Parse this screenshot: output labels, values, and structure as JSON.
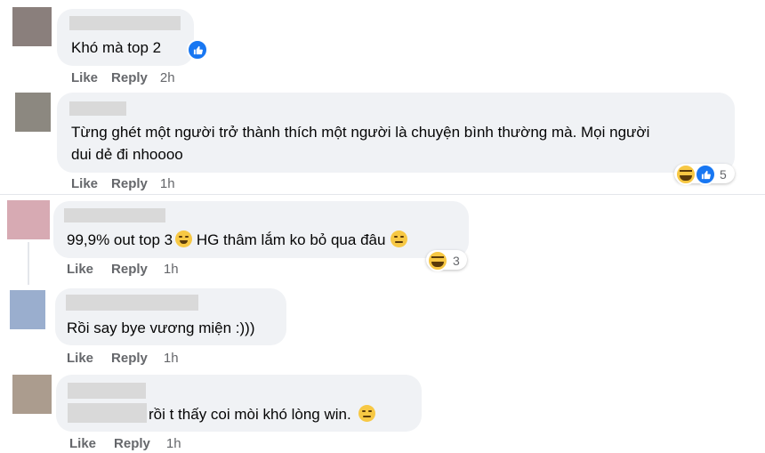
{
  "labels": {
    "like": "Like",
    "reply": "Reply"
  },
  "colors": {
    "bubble": "#f0f2f5",
    "action_text": "#65676b",
    "like_blue": "#1877f2",
    "haha_yellow": "#f7c844"
  },
  "comments": [
    {
      "text": "Khó mà top 2",
      "time": "2h",
      "reactions": [
        "like"
      ],
      "reaction_count": ""
    },
    {
      "text_line1": "Từng ghét một người trở thành thích một người là chuyện bình thường mà. Mọi người",
      "text_line2": "dui dẻ đi nhoooo",
      "time": "1h",
      "reactions": [
        "haha",
        "like"
      ],
      "reaction_count": "5"
    },
    {
      "text": "99,9% out top 3",
      "text_after": " HG thâm lắm ko bỏ qua đâu",
      "time": "1h",
      "reactions": [
        "haha"
      ],
      "reaction_count": "3"
    },
    {
      "text": "Rồi say bye vương miện :)))",
      "time": "1h",
      "reactions": [],
      "reaction_count": ""
    },
    {
      "text": "rồi t thấy coi mòi khó lòng win.",
      "time": "1h",
      "reactions": [],
      "reaction_count": ""
    }
  ]
}
